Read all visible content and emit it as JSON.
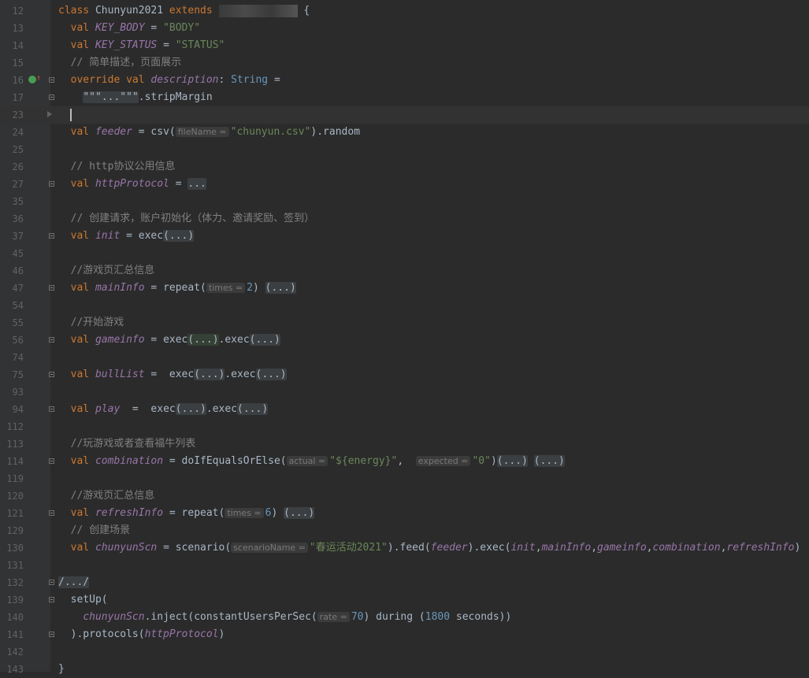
{
  "editor": {
    "lines": [
      {
        "num": "12",
        "tokens": [
          {
            "t": "class ",
            "c": "kw"
          },
          {
            "t": "Chunyun2021"
          },
          {
            "t": " extends ",
            "c": "kw"
          },
          {
            "t": "",
            "c": "blur"
          },
          {
            "t": " {"
          }
        ]
      },
      {
        "num": "13",
        "tokens": [
          {
            "t": "  val ",
            "c": "kw"
          },
          {
            "t": "KEY_BODY",
            "c": "fld"
          },
          {
            "t": " = "
          },
          {
            "t": "\"BODY\"",
            "c": "str"
          }
        ]
      },
      {
        "num": "14",
        "tokens": [
          {
            "t": "  val ",
            "c": "kw"
          },
          {
            "t": "KEY_STATUS",
            "c": "fld"
          },
          {
            "t": " = "
          },
          {
            "t": "\"STATUS\"",
            "c": "str"
          }
        ]
      },
      {
        "num": "15",
        "tokens": [
          {
            "t": "  // 简单描述，页面展示",
            "c": "cmt"
          }
        ]
      },
      {
        "num": "16",
        "fold": true,
        "override": true,
        "tokens": [
          {
            "t": "  override val ",
            "c": "kw"
          },
          {
            "t": "description",
            "c": "fld"
          },
          {
            "t": ": "
          },
          {
            "t": "String",
            "c": "typ"
          },
          {
            "t": " ="
          }
        ]
      },
      {
        "num": "17",
        "fold": true,
        "tokens": [
          {
            "t": "    "
          },
          {
            "t": "\"\"\"...\"\"\"",
            "c": "foldph"
          },
          {
            "t": ".stripMargin"
          }
        ]
      },
      {
        "num": "23",
        "current": true,
        "caret": true,
        "tokens": []
      },
      {
        "num": "24",
        "tokens": [
          {
            "t": "  val ",
            "c": "kw"
          },
          {
            "t": "feeder",
            "c": "fld"
          },
          {
            "t": " = csv("
          },
          {
            "t": "fileName =",
            "c": "hint"
          },
          {
            "t": "\"chunyun.csv\"",
            "c": "str"
          },
          {
            "t": ").random"
          }
        ]
      },
      {
        "num": "25",
        "tokens": []
      },
      {
        "num": "26",
        "tokens": [
          {
            "t": "  // http协议公用信息",
            "c": "cmt"
          }
        ]
      },
      {
        "num": "27",
        "fold": true,
        "tokens": [
          {
            "t": "  val ",
            "c": "kw"
          },
          {
            "t": "httpProtocol",
            "c": "fld"
          },
          {
            "t": " = "
          },
          {
            "t": "...",
            "c": "foldph"
          }
        ]
      },
      {
        "num": "35",
        "tokens": []
      },
      {
        "num": "36",
        "tokens": [
          {
            "t": "  // 创建请求，账户初始化（体力、邀请奖励、签到）",
            "c": "cmt"
          }
        ]
      },
      {
        "num": "37",
        "fold": true,
        "tokens": [
          {
            "t": "  val ",
            "c": "kw"
          },
          {
            "t": "init",
            "c": "fld"
          },
          {
            "t": " = exec"
          },
          {
            "t": "(...)",
            "c": "foldph"
          }
        ]
      },
      {
        "num": "45",
        "tokens": []
      },
      {
        "num": "46",
        "tokens": [
          {
            "t": "  //游戏页汇总信息",
            "c": "cmt"
          }
        ]
      },
      {
        "num": "47",
        "fold": true,
        "tokens": [
          {
            "t": "  val ",
            "c": "kw"
          },
          {
            "t": "mainInfo",
            "c": "fld"
          },
          {
            "t": " = repeat("
          },
          {
            "t": "times =",
            "c": "hint"
          },
          {
            "t": "2",
            "c": "num"
          },
          {
            "t": ") "
          },
          {
            "t": "(...)",
            "c": "foldph"
          }
        ]
      },
      {
        "num": "54",
        "tokens": []
      },
      {
        "num": "55",
        "tokens": [
          {
            "t": "  //开始游戏",
            "c": "cmt"
          }
        ]
      },
      {
        "num": "56",
        "fold": true,
        "tokens": [
          {
            "t": "  val ",
            "c": "kw"
          },
          {
            "t": "gameinfo",
            "c": "fld"
          },
          {
            "t": " = exec"
          },
          {
            "t": "(...)",
            "c": "foldph hl"
          },
          {
            "t": ".exec"
          },
          {
            "t": "(...)",
            "c": "foldph"
          }
        ]
      },
      {
        "num": "74",
        "tokens": []
      },
      {
        "num": "75",
        "fold": true,
        "tokens": [
          {
            "t": "  val ",
            "c": "kw"
          },
          {
            "t": "bullList",
            "c": "fld"
          },
          {
            "t": " =  exec"
          },
          {
            "t": "(...)",
            "c": "foldph"
          },
          {
            "t": ".exec"
          },
          {
            "t": "(...)",
            "c": "foldph"
          }
        ]
      },
      {
        "num": "93",
        "tokens": []
      },
      {
        "num": "94",
        "fold": true,
        "tokens": [
          {
            "t": "  val ",
            "c": "kw"
          },
          {
            "t": "play",
            "c": "fld"
          },
          {
            "t": "  =  exec"
          },
          {
            "t": "(...)",
            "c": "foldph"
          },
          {
            "t": ".exec"
          },
          {
            "t": "(...)",
            "c": "foldph"
          }
        ]
      },
      {
        "num": "112",
        "tokens": []
      },
      {
        "num": "113",
        "tokens": [
          {
            "t": "  //玩游戏或者查看福牛列表",
            "c": "cmt"
          }
        ]
      },
      {
        "num": "114",
        "fold": true,
        "tokens": [
          {
            "t": "  val ",
            "c": "kw"
          },
          {
            "t": "combination",
            "c": "fld"
          },
          {
            "t": " = doIfEqualsOrElse("
          },
          {
            "t": "actual =",
            "c": "hint"
          },
          {
            "t": "\"${",
            "c": "str"
          },
          {
            "t": "energy",
            "c": "str"
          },
          {
            "t": "}\"",
            "c": "str"
          },
          {
            "t": ",  "
          },
          {
            "t": "expected =",
            "c": "hint"
          },
          {
            "t": "\"0\"",
            "c": "str"
          },
          {
            "t": ")"
          },
          {
            "t": "(...)",
            "c": "foldph"
          },
          {
            "t": " "
          },
          {
            "t": "(...)",
            "c": "foldph"
          }
        ]
      },
      {
        "num": "119",
        "tokens": []
      },
      {
        "num": "120",
        "tokens": [
          {
            "t": "  //游戏页汇总信息",
            "c": "cmt"
          }
        ]
      },
      {
        "num": "121",
        "fold": true,
        "tokens": [
          {
            "t": "  val ",
            "c": "kw"
          },
          {
            "t": "refreshInfo",
            "c": "fld"
          },
          {
            "t": " = repeat("
          },
          {
            "t": "times =",
            "c": "hint"
          },
          {
            "t": "6",
            "c": "num"
          },
          {
            "t": ") "
          },
          {
            "t": "(...)",
            "c": "foldph"
          }
        ]
      },
      {
        "num": "129",
        "tokens": [
          {
            "t": "  // 创建场景",
            "c": "cmt"
          }
        ]
      },
      {
        "num": "130",
        "tokens": [
          {
            "t": "  val ",
            "c": "kw"
          },
          {
            "t": "chunyunScn",
            "c": "fld"
          },
          {
            "t": " = scenario("
          },
          {
            "t": "scenarioName =",
            "c": "hint"
          },
          {
            "t": "\"春运活动2021\"",
            "c": "str"
          },
          {
            "t": ").feed("
          },
          {
            "t": "feeder",
            "c": "fld"
          },
          {
            "t": ").exec("
          },
          {
            "t": "init",
            "c": "fld"
          },
          {
            "t": ","
          },
          {
            "t": "mainInfo",
            "c": "fld"
          },
          {
            "t": ","
          },
          {
            "t": "gameinfo",
            "c": "fld"
          },
          {
            "t": ","
          },
          {
            "t": "combination",
            "c": "fld"
          },
          {
            "t": ","
          },
          {
            "t": "refreshInfo",
            "c": "fld"
          },
          {
            "t": ")"
          }
        ]
      },
      {
        "num": "131",
        "tokens": []
      },
      {
        "num": "132",
        "fold": true,
        "tokens": [
          {
            "t": "/.../",
            "c": "foldph"
          }
        ]
      },
      {
        "num": "139",
        "fold": true,
        "tokens": [
          {
            "t": "  setUp("
          }
        ]
      },
      {
        "num": "140",
        "tokens": [
          {
            "t": "    "
          },
          {
            "t": "chunyunScn",
            "c": "fld"
          },
          {
            "t": ".inject(constantUsersPerSec("
          },
          {
            "t": "rate =",
            "c": "hint"
          },
          {
            "t": "70",
            "c": "num"
          },
          {
            "t": ") during ("
          },
          {
            "t": "1800",
            "c": "num"
          },
          {
            "t": " seconds))"
          }
        ]
      },
      {
        "num": "141",
        "fold": true,
        "tokens": [
          {
            "t": "  ).protocols("
          },
          {
            "t": "httpProtocol",
            "c": "fld"
          },
          {
            "t": ")"
          }
        ]
      },
      {
        "num": "142",
        "tokens": []
      },
      {
        "num": "143",
        "tokens": [
          {
            "t": "}"
          }
        ]
      }
    ]
  }
}
